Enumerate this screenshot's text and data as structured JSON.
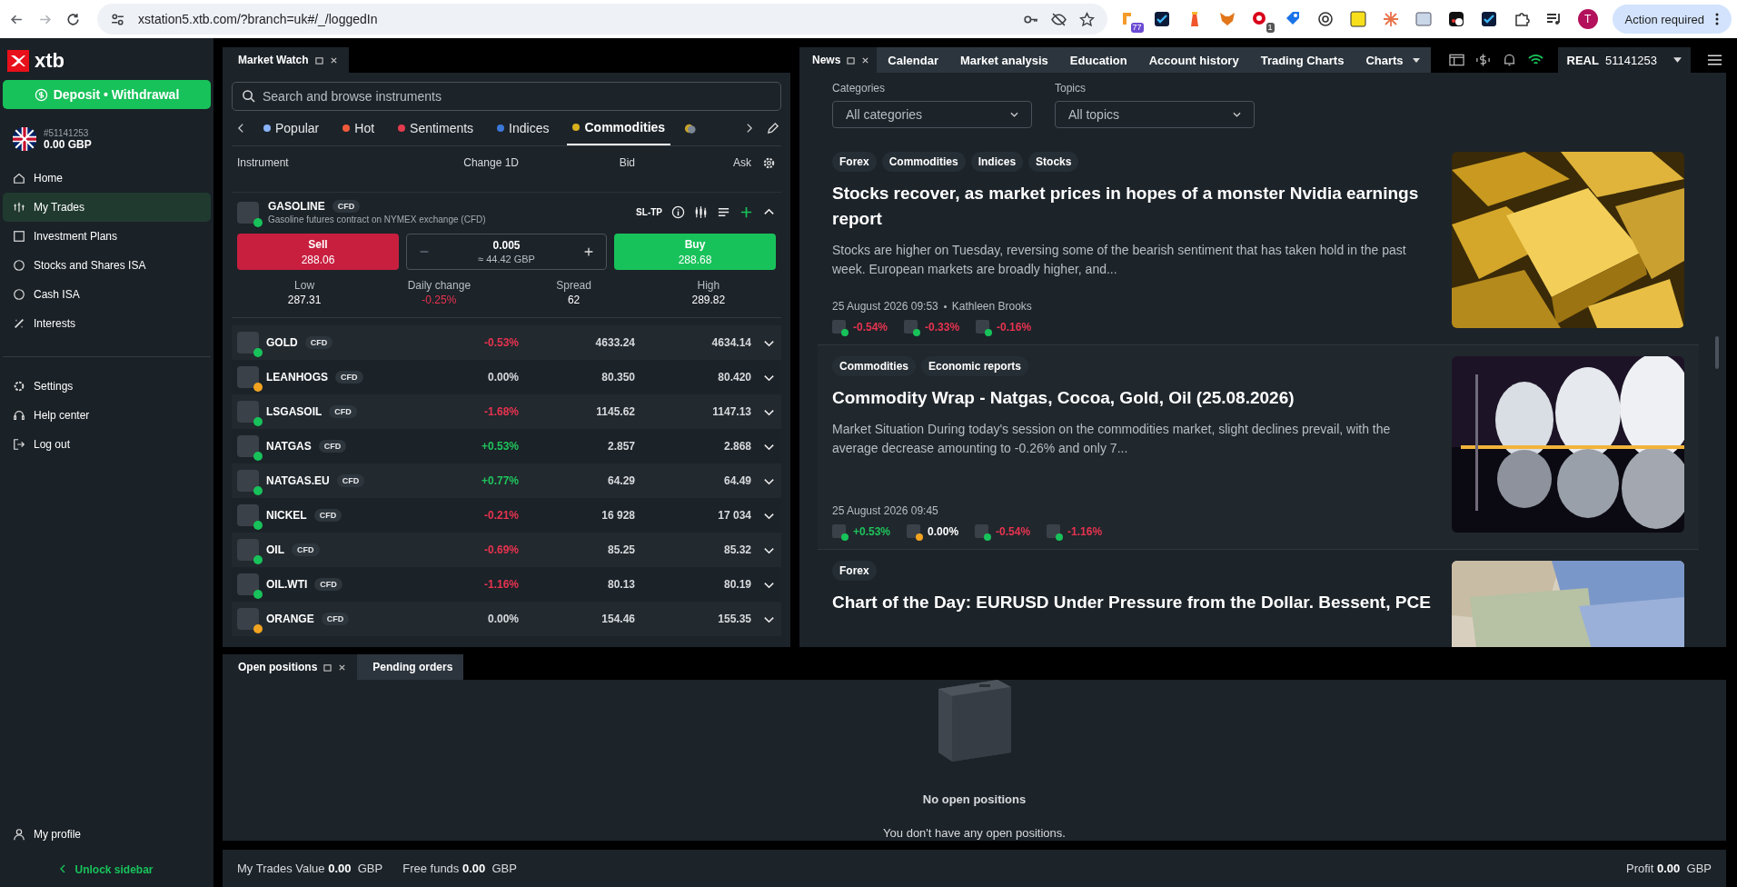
{
  "browser": {
    "url": "xstation5.xtb.com/?branch=uk#/_/loggedIn",
    "badges": [
      "77",
      "1"
    ],
    "profile_initial": "T",
    "action": "Action required"
  },
  "sidebar": {
    "logo": "xtb",
    "deposit": "Deposit • Withdrawal",
    "account_no": "#51141253",
    "balance": "0.00 GBP",
    "items": [
      {
        "label": "Home",
        "selected": false
      },
      {
        "label": "My Trades",
        "selected": true
      },
      {
        "label": "Investment Plans",
        "selected": false
      },
      {
        "label": "Stocks and Shares ISA",
        "selected": false
      },
      {
        "label": "Cash ISA",
        "selected": false
      },
      {
        "label": "Interests",
        "selected": false
      }
    ],
    "items2": [
      {
        "label": "Settings",
        "selected": false
      },
      {
        "label": "Help center",
        "selected": false
      },
      {
        "label": "Log out",
        "selected": false
      }
    ],
    "profile": "My profile",
    "unlock": "Unlock sidebar"
  },
  "market_watch": {
    "title": "Market Watch",
    "search": {
      "placeholder": "Search and browse instruments"
    },
    "tabs": [
      {
        "label": "Popular",
        "selected": false
      },
      {
        "label": "Hot",
        "selected": false
      },
      {
        "label": "Sentiments",
        "selected": false
      },
      {
        "label": "Indices",
        "selected": false
      },
      {
        "label": "Commodities",
        "selected": true
      }
    ],
    "columns": [
      "Instrument",
      "Change 1D",
      "Bid",
      "Ask"
    ],
    "expanded": {
      "name": "GASOLINE",
      "badge": "CFD",
      "description": "Gasoline futures contract on NYMEX exchange (CFD)",
      "sl_tp": "SL-TP",
      "sell_label": "Sell",
      "sell_price": "288.06",
      "volume": "0.005",
      "approx": "≈ 44.42 GBP",
      "buy_label": "Buy",
      "buy_price": "288.68",
      "stats": [
        {
          "label": "Low",
          "value": "287.31",
          "color": "#ffffff"
        },
        {
          "label": "Daily change",
          "value": "-0.25%",
          "color": "#e8334f"
        },
        {
          "label": "Spread",
          "value": "62",
          "color": "#ffffff"
        },
        {
          "label": "High",
          "value": "289.82",
          "color": "#ffffff"
        }
      ]
    },
    "rows": [
      {
        "name": "GOLD",
        "badge": "CFD",
        "change": "-0.53%",
        "color": "#e8334f",
        "bid": "4633.24",
        "ask": "4634.14",
        "open": true
      },
      {
        "name": "LEANHOGS",
        "badge": "CFD",
        "change": "0.00%",
        "color": "#d7dadd",
        "bid": "80.350",
        "ask": "80.420",
        "open": false
      },
      {
        "name": "LSGASOIL",
        "badge": "CFD",
        "change": "-1.68%",
        "color": "#e8334f",
        "bid": "1145.62",
        "ask": "1147.13",
        "open": true
      },
      {
        "name": "NATGAS",
        "badge": "CFD",
        "change": "+0.53%",
        "color": "#1fc45c",
        "bid": "2.857",
        "ask": "2.868",
        "open": true
      },
      {
        "name": "NATGAS.EU",
        "badge": "CFD",
        "change": "+0.77%",
        "color": "#1fc45c",
        "bid": "64.29",
        "ask": "64.49",
        "open": true
      },
      {
        "name": "NICKEL",
        "badge": "CFD",
        "change": "-0.21%",
        "color": "#e8334f",
        "bid": "16 928",
        "ask": "17 034",
        "open": true
      },
      {
        "name": "OIL",
        "badge": "CFD",
        "change": "-0.69%",
        "color": "#e8334f",
        "bid": "85.25",
        "ask": "85.32",
        "open": true
      },
      {
        "name": "OIL.WTI",
        "badge": "CFD",
        "change": "-1.16%",
        "color": "#e8334f",
        "bid": "80.13",
        "ask": "80.19",
        "open": true
      },
      {
        "name": "ORANGE",
        "badge": "CFD",
        "change": "0.00%",
        "color": "#d7dadd",
        "bid": "154.46",
        "ask": "155.35",
        "open": false
      }
    ]
  },
  "news": {
    "tabs": [
      {
        "label": "News",
        "selected": true
      },
      {
        "label": "Calendar",
        "selected": false
      },
      {
        "label": "Market analysis",
        "selected": false
      },
      {
        "label": "Education",
        "selected": false
      },
      {
        "label": "Account history",
        "selected": false
      },
      {
        "label": "Trading Charts",
        "selected": false
      },
      {
        "label": "Charts",
        "selected": false
      }
    ],
    "account": {
      "type": "REAL",
      "number": "51141253"
    },
    "filters": [
      {
        "label": "Categories",
        "value": "All categories"
      },
      {
        "label": "Topics",
        "value": "All topics"
      }
    ],
    "articles": [
      {
        "tags": [
          "Forex",
          "Commodities",
          "Indices",
          "Stocks"
        ],
        "title": "Stocks recover, as market prices in hopes of a monster Nvidia earnings report",
        "summary": "Stocks are higher on Tuesday, reversing some of the bearish sentiment that has taken hold in the past week. European markets are broadly higher, and...",
        "date": "25 August 2026 09:53",
        "author": "Kathleen Brooks",
        "tickers": [
          {
            "change": "-0.54%",
            "color": "#e8334f",
            "open": true
          },
          {
            "change": "-0.33%",
            "color": "#e8334f",
            "open": true
          },
          {
            "change": "-0.16%",
            "color": "#e8334f",
            "open": true
          }
        ]
      },
      {
        "tags": [
          "Commodities",
          "Economic reports"
        ],
        "title": "Commodity Wrap - Natgas, Cocoa, Gold, Oil (25.08.2026)",
        "summary": "Market Situation During today's session on the commodities market, slight declines prevail, with the average decrease amounting to -0.26% and only 7...",
        "date": "25 August 2026 09:45",
        "tickers": [
          {
            "change": "+0.53%",
            "color": "#1fc45c",
            "open": true
          },
          {
            "change": "0.00%",
            "color": "#ffffff",
            "open": false
          },
          {
            "change": "-0.54%",
            "color": "#e8334f",
            "open": true
          },
          {
            "change": "-1.16%",
            "color": "#e8334f",
            "open": true
          }
        ]
      },
      {
        "tags": [
          "Forex"
        ],
        "title": "Chart of the Day: EURUSD Under Pressure from the Dollar. Bessent, PCE"
      }
    ]
  },
  "positions": {
    "tabs": [
      {
        "label": "Open positions",
        "selected": true
      },
      {
        "label": "Pending orders",
        "selected": false
      }
    ],
    "empty_title": "No open positions",
    "empty_text": "You don't have any open positions."
  },
  "status_bar": [
    {
      "label": "My Trades Value",
      "value": "0.00",
      "currency": "GBP"
    },
    {
      "label": "Free funds",
      "value": "0.00",
      "currency": "GBP"
    },
    {
      "label": "Profit",
      "value": "0.00",
      "currency": "GBP"
    }
  ]
}
